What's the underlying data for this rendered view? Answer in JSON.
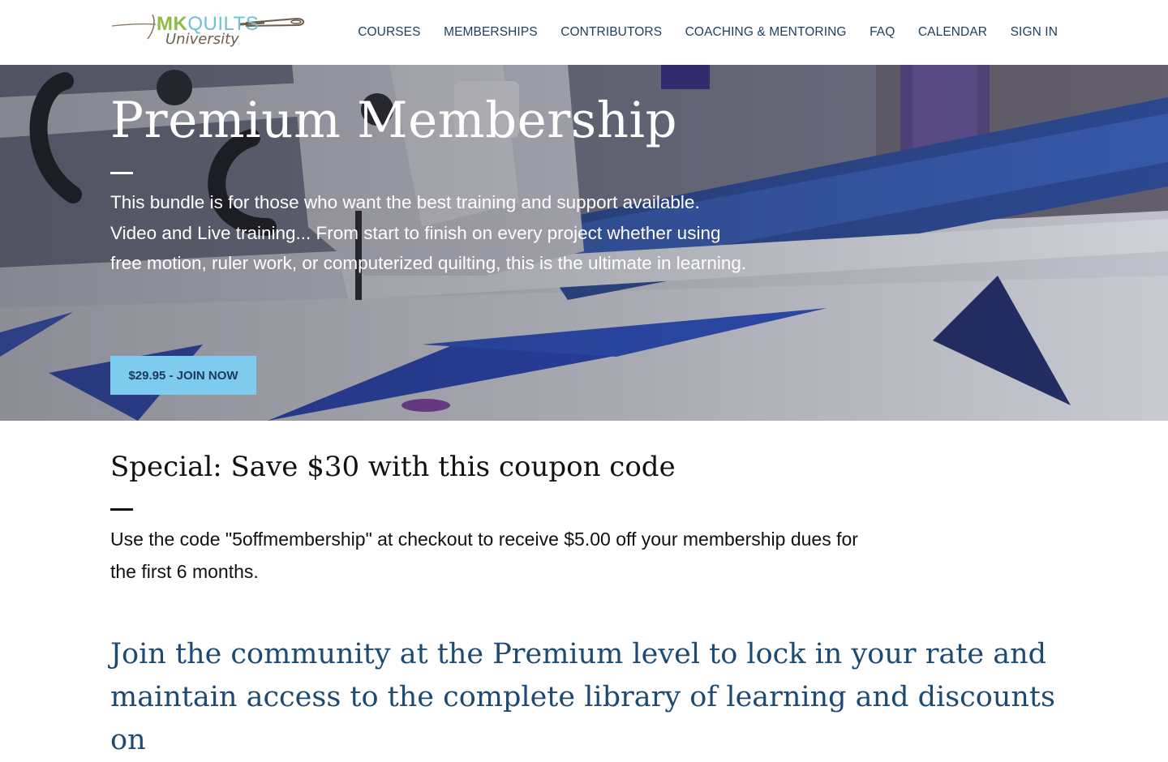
{
  "brand": {
    "logo_mk": "MK",
    "logo_quilts": "QUILTS",
    "logo_sub": "University"
  },
  "nav": {
    "items": [
      {
        "label": "COURSES"
      },
      {
        "label": "MEMBERSHIPS"
      },
      {
        "label": "CONTRIBUTORS"
      },
      {
        "label": "COACHING & MENTORING"
      },
      {
        "label": "FAQ"
      },
      {
        "label": "CALENDAR"
      },
      {
        "label": "SIGN IN"
      }
    ]
  },
  "hero": {
    "title": "Premium Membership",
    "description": "This bundle is for those who want the best training and support available. Video and Live training... From start to finish on every project whether using free motion, ruler work, or computerized quilting, this is the ultimate in learning.",
    "cta_label": "$29.95 - JOIN NOW"
  },
  "special": {
    "title": "Special: Save $30 with this coupon code",
    "text": "Use the code \"5offmembership\" at checkout to receive $5.00 off your membership dues for the first 6 months."
  },
  "community": {
    "heading": "Join the community at the Premium level to lock in your rate and maintain access to the complete library of learning and discounts on"
  },
  "colors": {
    "nav_text": "#1f3d5c",
    "cta_bg": "#7ecbf0",
    "cta_text": "#1b3a58",
    "heading_blue": "#1d4a73",
    "logo_green": "#8dbb4a",
    "logo_teal": "#6ec1d6",
    "logo_brown": "#6d5d4b"
  },
  "icons": {
    "logo_mark": "needle-thread-icon"
  }
}
